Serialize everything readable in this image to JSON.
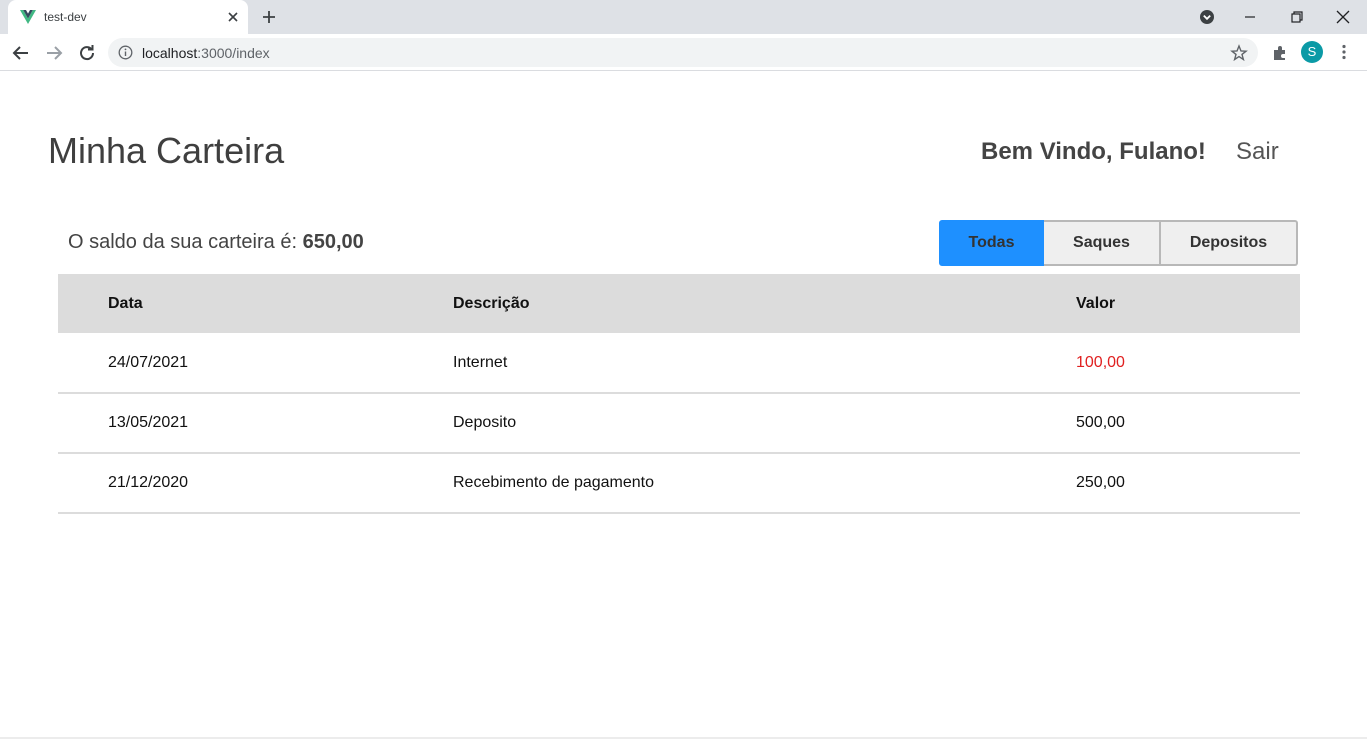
{
  "browser": {
    "tab_title": "test-dev",
    "url_host": "localhost",
    "url_path": ":3000/index",
    "profile_initial": "S"
  },
  "header": {
    "title": "Minha Carteira",
    "welcome": "Bem Vindo, Fulano!",
    "logout": "Sair"
  },
  "balance": {
    "label": "O saldo da sua carteira é: ",
    "amount": "650,00"
  },
  "filters": [
    {
      "label": "Todas",
      "active": true
    },
    {
      "label": "Saques",
      "active": false
    },
    {
      "label": "Depositos",
      "active": false
    }
  ],
  "table": {
    "columns": [
      "Data",
      "Descrição",
      "Valor"
    ],
    "rows": [
      {
        "date": "24/07/2021",
        "description": "Internet",
        "value": "100,00",
        "negative": true
      },
      {
        "date": "13/05/2021",
        "description": "Deposito",
        "value": "500,00",
        "negative": false
      },
      {
        "date": "21/12/2020",
        "description": "Recebimento de pagamento",
        "value": "250,00",
        "negative": false
      }
    ]
  },
  "colors": {
    "accent": "#1e90ff",
    "negative": "#e02020",
    "header_bg": "#dcdcdc"
  }
}
